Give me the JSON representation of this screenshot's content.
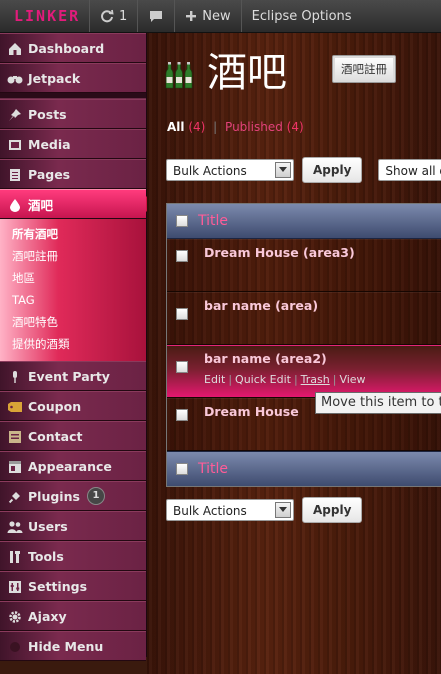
{
  "admin_bar": {
    "logo": "LINKER",
    "updates_count": "1",
    "new_label": "New",
    "eclipse_label": "Eclipse Options"
  },
  "sidebar": {
    "items": [
      {
        "label": "Dashboard",
        "icon": "dashboard-icon"
      },
      {
        "label": "Jetpack",
        "icon": "jetpack-icon"
      },
      {
        "label": "Posts",
        "icon": "pin-icon"
      },
      {
        "label": "Media",
        "icon": "media-icon"
      },
      {
        "label": "Pages",
        "icon": "pages-icon"
      },
      {
        "label": "酒吧",
        "icon": "drop-icon"
      },
      {
        "label": "Event Party",
        "icon": "microphone-icon"
      },
      {
        "label": "Coupon",
        "icon": "ticket-icon"
      },
      {
        "label": "Contact",
        "icon": "contact-icon"
      },
      {
        "label": "Appearance",
        "icon": "appearance-icon"
      },
      {
        "label": "Plugins",
        "icon": "plug-icon",
        "badge": "1"
      },
      {
        "label": "Users",
        "icon": "users-icon"
      },
      {
        "label": "Tools",
        "icon": "tools-icon"
      },
      {
        "label": "Settings",
        "icon": "settings-icon"
      },
      {
        "label": "Ajaxy",
        "icon": "gear-icon"
      },
      {
        "label": "Hide Menu",
        "icon": "hide-menu-icon"
      }
    ],
    "submenu": [
      "所有酒吧",
      "酒吧註冊",
      "地區",
      "TAG",
      "酒吧特色",
      "提供的酒類"
    ]
  },
  "main": {
    "title": "酒吧",
    "add_new": "酒吧註冊",
    "filters": {
      "all": "All",
      "all_count": "(4)",
      "published": "Published",
      "published_count": "(4)"
    },
    "bulk_actions": "Bulk Actions",
    "apply": "Apply",
    "show_all": "Show all da",
    "table": {
      "column_title": "Title",
      "rows": [
        {
          "title": "Dream House (area3)"
        },
        {
          "title": "bar name (area)"
        },
        {
          "title": "bar name (area2)"
        },
        {
          "title": "Dream House"
        }
      ],
      "row_actions": {
        "edit": "Edit",
        "quick_edit": "Quick Edit",
        "trash": "Trash",
        "view": "View"
      }
    },
    "tooltip": "Move this item to th"
  },
  "colors": {
    "accent": "#e8196e",
    "header_blue": "#5a678d"
  }
}
